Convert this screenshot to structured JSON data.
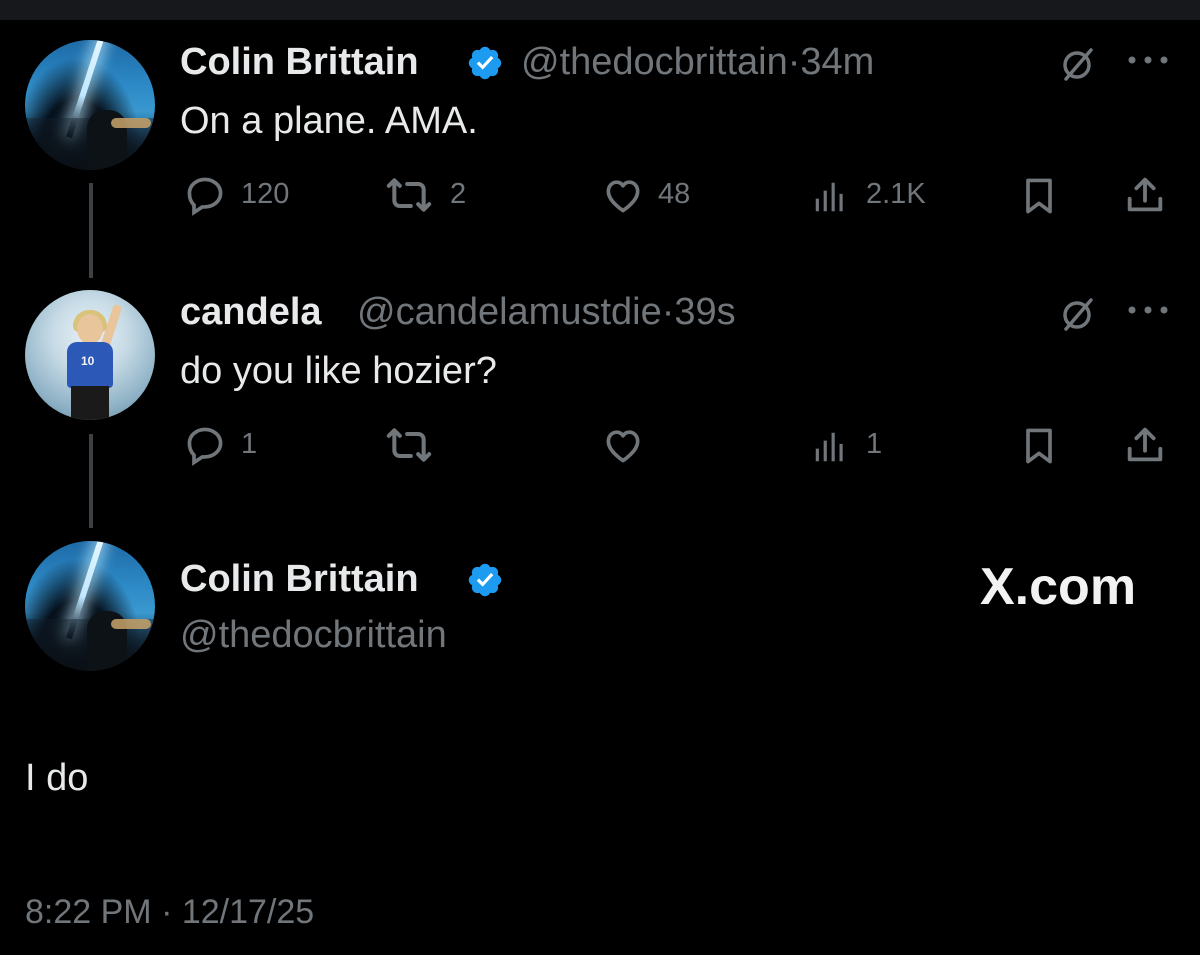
{
  "tweets": [
    {
      "author_name": "Colin Brittain",
      "handle_and_time": "@thedocbrittain·34m",
      "text": "On a plane.  AMA.",
      "replies": "120",
      "reposts": "2",
      "likes": "48",
      "views": "2.1K"
    },
    {
      "author_name": "candela",
      "handle_and_time": "@candelamustdie·39s",
      "text": "do you like hozier?",
      "replies": "1",
      "reposts": "",
      "likes": "",
      "views": "1"
    }
  ],
  "reply": {
    "author_name": "Colin Brittain",
    "handle": "@thedocbrittain",
    "text": "I do",
    "timestamp": "8:22 PM · 12/17/25"
  },
  "watermark": "X.com",
  "colors": {
    "background": "#000000",
    "text": "#e7e9ea",
    "muted": "#71767b",
    "verified": "#1d9bf0"
  }
}
